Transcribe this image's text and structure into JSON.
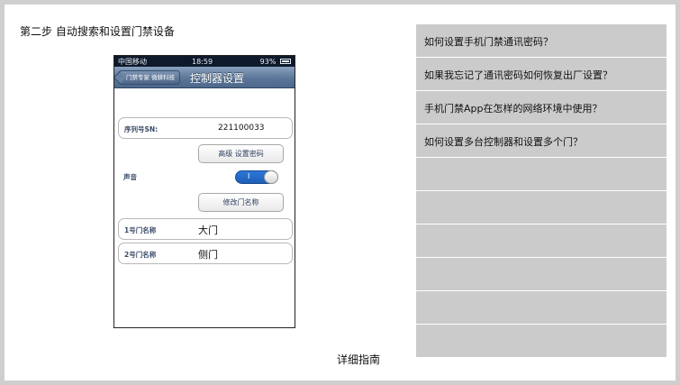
{
  "step_title": "第二步 自动搜索和设置门禁设备",
  "guide_link": "详细指南",
  "phone": {
    "status": {
      "carrier": "中国移动",
      "time": "18:59",
      "battery": "93%"
    },
    "navbar": {
      "back": "门禁专家 微耕科技",
      "title": "控制器设置"
    },
    "sn": {
      "label": "序列号SN:",
      "value": "221100033"
    },
    "password_button": "高级 设置密码",
    "sound": {
      "label": "声音",
      "toggle": "I"
    },
    "rename_button": "修改门名称",
    "doors": [
      {
        "label": "1号门名称",
        "value": "大门"
      },
      {
        "label": "2号门名称",
        "value": "侧门"
      }
    ]
  },
  "faq": [
    "如何设置手机门禁通讯密码？",
    "如果我忘记了通讯密码如何恢复出厂设置？",
    "手机门禁App在怎样的网络环境中使用？",
    "如何设置多台控制器和设置多个门？",
    "",
    "",
    "",
    "",
    "",
    ""
  ]
}
